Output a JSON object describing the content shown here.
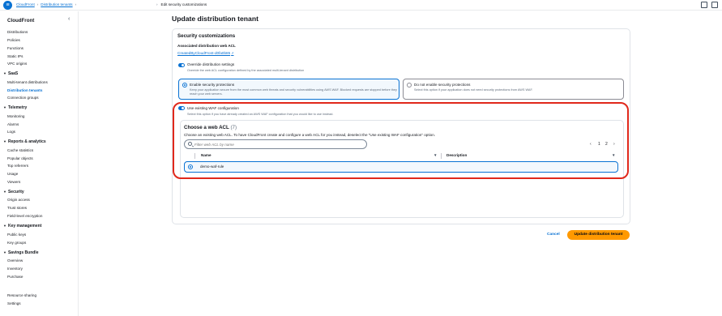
{
  "breadcrumb": {
    "items": [
      "CloudFront",
      "Distribution tenants"
    ],
    "current": "Edit security customizations"
  },
  "sidebar": {
    "title": "CloudFront",
    "top_items": [
      "Distributions",
      "Policies",
      "Functions",
      "Static IPs",
      "VPC origins"
    ],
    "sections": [
      {
        "title": "SaaS",
        "items": [
          "Multi-tenant distributions",
          "Distribution tenants",
          "Connection groups"
        ]
      },
      {
        "title": "Telemetry",
        "items": [
          "Monitoring",
          "Alarms",
          "Logs"
        ]
      },
      {
        "title": "Reports & analytics",
        "items": [
          "Cache statistics",
          "Popular objects",
          "Top referrers",
          "Usage",
          "Viewers"
        ]
      },
      {
        "title": "Security",
        "items": [
          "Origin access",
          "Trust stores",
          "Field-level encryption"
        ]
      },
      {
        "title": "Key management",
        "items": [
          "Public keys",
          "Key groups"
        ]
      },
      {
        "title": "Savings Bundle",
        "items": [
          "Overview",
          "Inventory",
          "Purchase"
        ]
      }
    ],
    "bottom_items": [
      "Resource sharing",
      "Settings"
    ],
    "active_item": "Distribution tenants"
  },
  "page": {
    "title": "Update distribution tenant",
    "section_title": "Security customizations",
    "associated_label": "Associated distribution web ACL",
    "associated_link": "CreatedByCloudFront-d0fa0b85",
    "override": {
      "label": "Override distribution settings",
      "desc": "Override the web ACL configuration defined by the associated multi-tenant distribution"
    },
    "options": [
      {
        "title": "Enable security protections",
        "desc": "Keep your application secure from the most common web threats and security vulnerabilities using AWS WAF. Blocked requests are stopped before they reach your web servers."
      },
      {
        "title": "Do not enable security protections",
        "desc": "Select this option if your application does not need security protections from AWS WAF."
      }
    ],
    "use_existing": {
      "label": "Use existing WAF configuration",
      "desc": "Select this option if you have already created an AWS WAF configuration that you would like to use instead."
    },
    "acl": {
      "title": "Choose a web ACL",
      "count": "(7)",
      "desc": "Choose an existing web ACL. To have CloudFront create and configure a web ACL for you instead, deselect the \"Use existing WAF configuration\" option.",
      "filter_placeholder": "Filter web ACL by name",
      "pages": [
        "1",
        "2"
      ],
      "columns": [
        "Name",
        "Description"
      ],
      "rows": [
        {
          "name": "demo-waf-rule",
          "description": ""
        }
      ]
    },
    "cancel_label": "Cancel",
    "submit_label": "Update distribution tenant"
  },
  "colors": {
    "accent": "#0972d3",
    "primary_button": "#ff9900",
    "highlight": "#e0281b"
  }
}
